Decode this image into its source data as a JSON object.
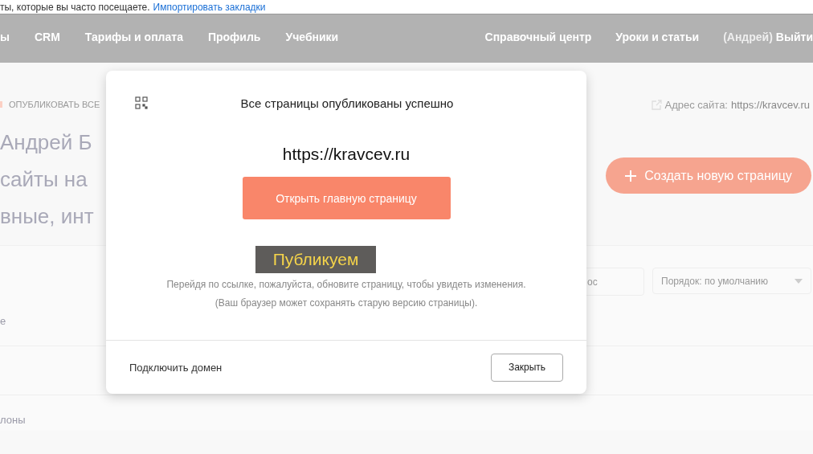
{
  "browser_bar": {
    "text": "ты, которые вы часто посещаете.",
    "link": "Импортировать закладки"
  },
  "nav": {
    "left": [
      "ы",
      "CRM",
      "Тарифы и оплата",
      "Профиль",
      "Учебники"
    ],
    "right": [
      "Справочный центр",
      "Уроки и статьи"
    ],
    "user": "(Андрей)",
    "logout": "Выйти"
  },
  "page": {
    "publish_all": "ОПУБЛИКОВАТЬ ВСЕ",
    "address_label": "Адрес сайта:",
    "address": "https://kravcev.ru",
    "headline": [
      "Андрей Б",
      "сайты на",
      "вные, инт"
    ],
    "create_button": "Создать новую страницу",
    "search_placeholder": "ос",
    "sort": "Порядок: по умолчанию",
    "row_1": "е",
    "row_2": "лоны"
  },
  "modal": {
    "title": "Все страницы опубликованы успешно",
    "url": "https://kravcev.ru",
    "open_button": "Открыть главную страницу",
    "hint": [
      "Перейдя по ссылке, пожалуйста, обновите страницу, чтобы увидеть изменения.",
      "(Ваш браузер может сохранять старую версию страницы)."
    ],
    "connect_domain": "Подключить домен",
    "close_button": "Закрыть"
  },
  "toast": {
    "text": "Публикуем"
  }
}
